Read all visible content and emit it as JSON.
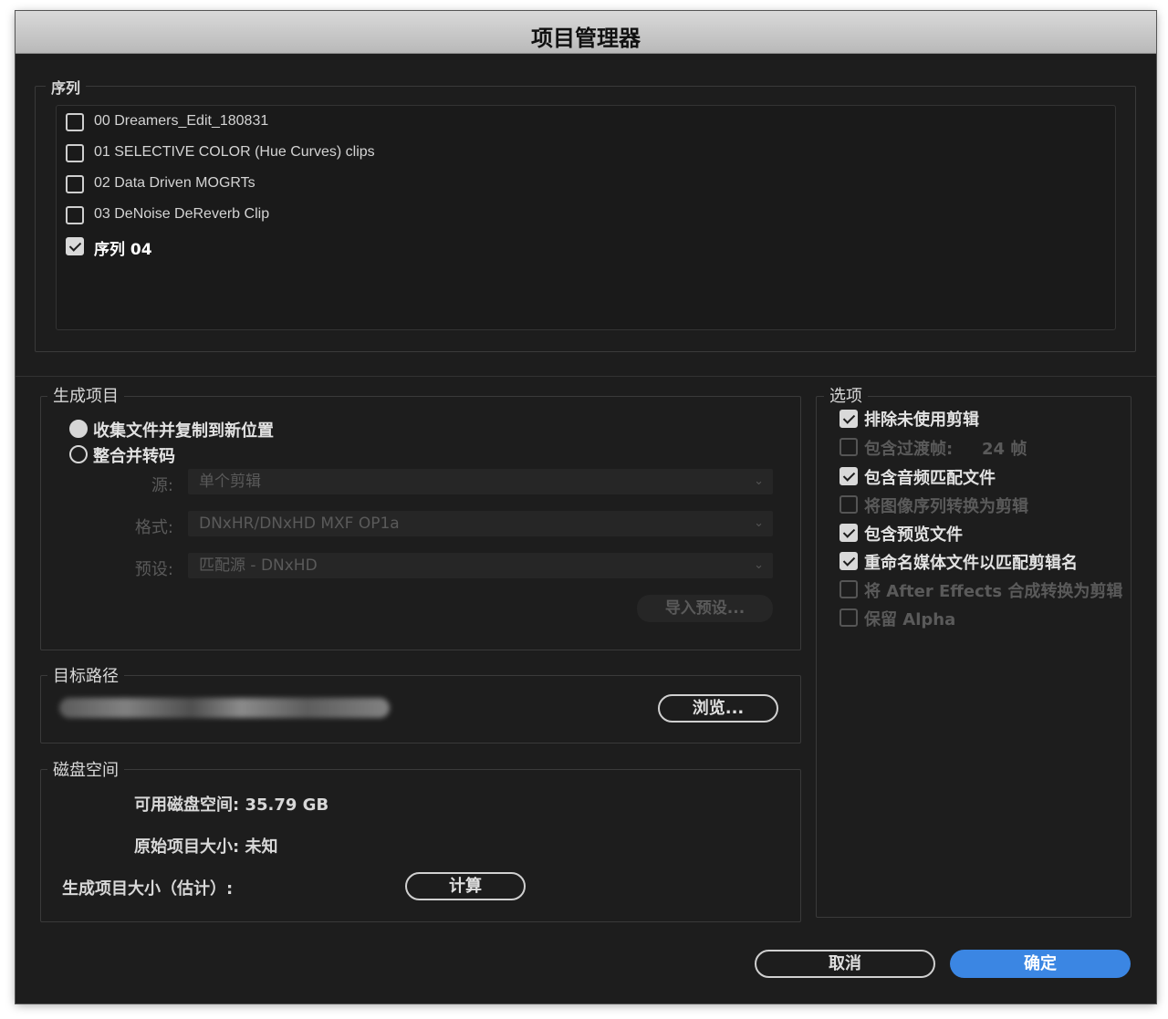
{
  "window": {
    "title": "项目管理器"
  },
  "sequences": {
    "label": "序列",
    "items": [
      {
        "label": "00 Dreamers_Edit_180831",
        "checked": false
      },
      {
        "label": "01 SELECTIVE COLOR (Hue Curves) clips",
        "checked": false
      },
      {
        "label": "02 Data Driven MOGRTs",
        "checked": false
      },
      {
        "label": "03 DeNoise DeReverb Clip",
        "checked": false
      },
      {
        "label": "序列 04",
        "checked": true
      }
    ]
  },
  "generate": {
    "label": "生成项目",
    "radio_collect": "收集文件并复制到新位置",
    "radio_consolidate": "整合并转码",
    "source_label": "源:",
    "source_value": "单个剪辑",
    "format_label": "格式:",
    "format_value": "DNxHR/DNxHD MXF OP1a",
    "preset_label": "预设:",
    "preset_value": "匹配源 - DNxHD",
    "import_preset": "导入预设..."
  },
  "target": {
    "label": "目标路径",
    "browse": "浏览..."
  },
  "disk": {
    "label": "磁盘空间",
    "available": "可用磁盘空间: 35.79 GB",
    "original": "原始项目大小: 未知",
    "estimated": "生成项目大小（估计）:",
    "calculate": "计算"
  },
  "options": {
    "label": "选项",
    "items": [
      {
        "label": "排除未使用剪辑",
        "checked": true,
        "enabled": true
      },
      {
        "label": "包含过渡帧:",
        "checked": false,
        "enabled": false,
        "suffix": "24 帧"
      },
      {
        "label": "包含音频匹配文件",
        "checked": true,
        "enabled": true
      },
      {
        "label": "将图像序列转换为剪辑",
        "checked": false,
        "enabled": false
      },
      {
        "label": "包含预览文件",
        "checked": true,
        "enabled": true
      },
      {
        "label": "重命名媒体文件以匹配剪辑名",
        "checked": true,
        "enabled": true
      },
      {
        "label": "将 After Effects 合成转换为剪辑",
        "checked": false,
        "enabled": false
      },
      {
        "label": "保留 Alpha",
        "checked": false,
        "enabled": false
      }
    ]
  },
  "footer": {
    "cancel": "取消",
    "ok": "确定"
  },
  "colors": {
    "primary": "#3b86e3",
    "background": "#1d1d1d"
  }
}
